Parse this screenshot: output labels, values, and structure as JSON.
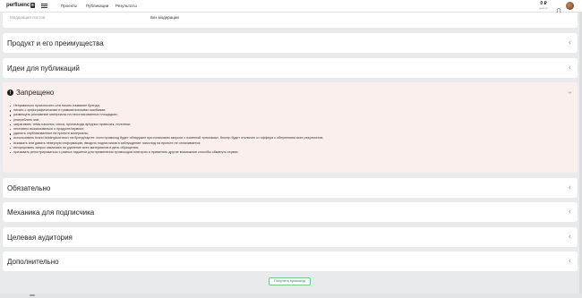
{
  "header": {
    "logo_text": "perfluenc",
    "logo_badge": "e",
    "nav": [
      "Проекты",
      "Публикации",
      "Результаты"
    ],
    "balance_amount": "0 ₽",
    "balance_label": "доступ"
  },
  "moderation": {
    "label": "Модерация постов",
    "value": "Без модерации"
  },
  "sections": {
    "product": "Продукт и его преимущества",
    "ideas": "Идеи для публикаций",
    "forbidden": "Запрещено",
    "required": "Обязательно",
    "mechanics": "Механика для подписчика",
    "audience": "Целевая аудитория",
    "additional": "Дополнительно"
  },
  "forbidden_rules": [
    "Неправильно произносить или писать название бренда;",
    "писать с орфографическими и грамматическими ошибками;",
    "размещать рекламные материалы на несогласованных площадках;",
    "употреблять мат;",
    "затрагивать темы насилия, секса, пропаганды вредных привычек, политики;",
    "негативно высказываться о продукте/сервисе;",
    "удалять опубликованные на проекте материалы;",
    "использовать brand bidding/контекст на бренд/таргет: если промокод будет обнаружен при поисковом запросе с пометкой «реклама», блогер будет отключен от оффера с обнулением всех результатов;",
    "искажать или давать неверную информацию, вводить подписчиков в заблуждение: мисслид на проекте не оплачивается;",
    "игнорировать запрос заказчика на удаление всех материалов в день обращения;",
    "призывать регистрироваться с разных гаджетов для применения промокодов повторно и применять другие возможные способы обмануть сервис."
  ],
  "actions": {
    "get_promo": "Получить промокод"
  }
}
